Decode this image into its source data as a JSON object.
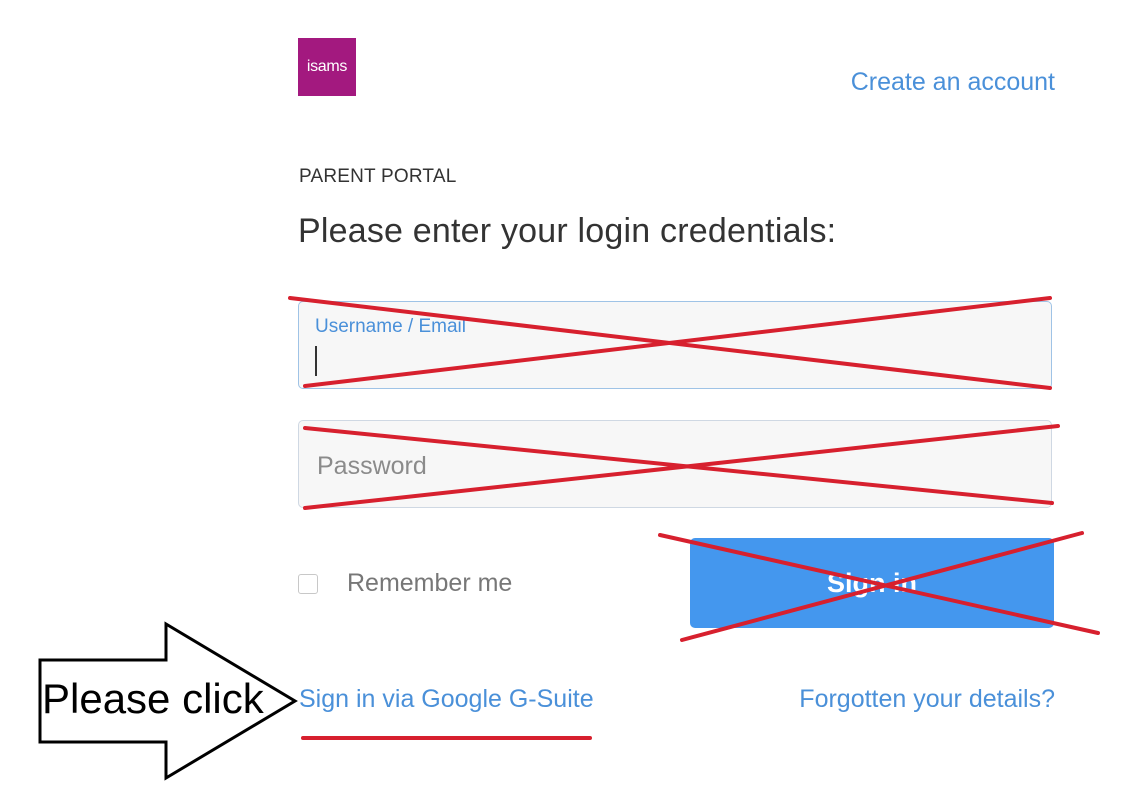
{
  "logo": {
    "text": "isams",
    "color": "#a3197f"
  },
  "header": {
    "create_account": "Create an account"
  },
  "portal": {
    "label": "PARENT PORTAL",
    "headline": "Please enter your login credentials:"
  },
  "form": {
    "username_label": "Username / Email",
    "username_value": "",
    "password_placeholder": "Password",
    "password_value": "",
    "remember_label": "Remember me",
    "remember_checked": false,
    "signin_label": "Sign in"
  },
  "links": {
    "google": "Sign in via Google G-Suite",
    "forgot": "Forgotten your details?"
  },
  "annotation": {
    "arrow_text": "Please click",
    "cross_color": "#d7202e"
  },
  "colors": {
    "link": "#4a90d9",
    "button": "#4497ee"
  }
}
